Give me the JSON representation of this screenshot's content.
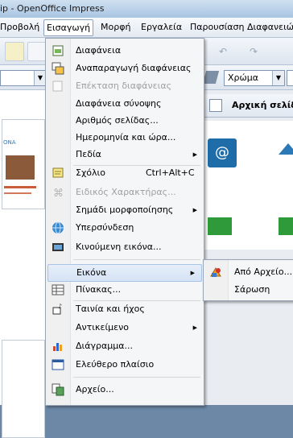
{
  "window": {
    "title": "ip - OpenOffice Impress"
  },
  "menubar": [
    {
      "label": "Προβολή"
    },
    {
      "label": "Εισαγωγή"
    },
    {
      "label": "Μορφή"
    },
    {
      "label": "Εργαλεία"
    },
    {
      "label": "Παρουσίαση Διαφανειών"
    }
  ],
  "toolbar": {
    "color_mode_value": "Χρώμα"
  },
  "taskpane": {
    "title": "Αρχική σελίδ"
  },
  "preview": {
    "text": "ΟΝΑ"
  },
  "insert_menu": [
    {
      "label": "Διαφάνεια",
      "icon": "new-slide-icon",
      "enabled": true
    },
    {
      "label": "Αναπαραγωγή διαφάνειας",
      "icon": "duplicate-slide-icon",
      "enabled": true
    },
    {
      "label": "Επέκταση διαφάνειας",
      "icon": "expand-slide-icon",
      "enabled": false
    },
    {
      "label": "Διαφάνεια σύνοψης",
      "enabled": true
    },
    {
      "label": "Αριθμός σελίδας...",
      "enabled": true
    },
    {
      "label": "Ημερομηνία και ώρα...",
      "enabled": true
    },
    {
      "label": "Πεδία",
      "enabled": true,
      "submenu": true
    },
    {
      "label": "Σχόλιο",
      "shortcut": "Ctrl+Alt+C",
      "icon": "comment-icon",
      "enabled": true
    },
    {
      "label": "Ειδικός Χαρακτήρας...",
      "icon": "special-character-icon",
      "enabled": false
    },
    {
      "label": "Σημάδι μορφοποίησης",
      "enabled": true,
      "submenu": true
    },
    {
      "label": "Υπερσύνδεση",
      "icon": "hyperlink-icon",
      "enabled": true
    },
    {
      "label": "Κινούμενη εικόνα...",
      "icon": "animated-image-icon",
      "enabled": true
    },
    {
      "label": "Εικόνα",
      "enabled": true,
      "submenu": true,
      "highlighted": true
    },
    {
      "label": "Πίνακας...",
      "icon": "table-icon",
      "enabled": true
    },
    {
      "label": "Ταινία και ήχος",
      "icon": "movie-sound-icon",
      "enabled": true
    },
    {
      "label": "Αντικείμενο",
      "enabled": true,
      "submenu": true
    },
    {
      "label": "Διάγραμμα...",
      "icon": "chart-icon",
      "enabled": true
    },
    {
      "label": "Ελεύθερο πλαίσιο",
      "icon": "floating-frame-icon",
      "enabled": true
    },
    {
      "label": "Αρχείο...",
      "icon": "file-icon",
      "enabled": true
    }
  ],
  "image_submenu": [
    {
      "label": "Από Αρχείο...",
      "icon": "from-file-icon"
    },
    {
      "label": "Σάρωση"
    }
  ],
  "colors": {
    "menu_bg": "#f5f6f7",
    "highlight": "#d5e3f6",
    "disabled_text": "#a0a0a0"
  }
}
